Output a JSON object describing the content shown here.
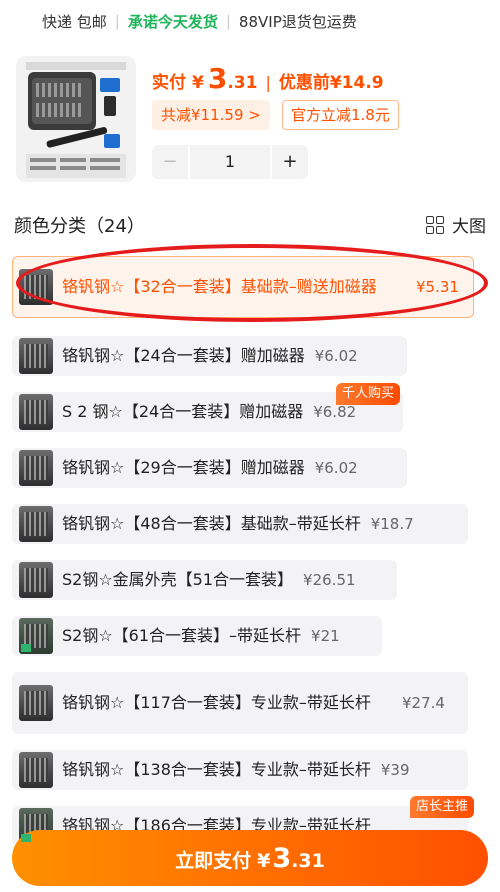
{
  "topbar": {
    "express": "快递 包邮",
    "promise": "承诺今天发货",
    "vip": "88VIP退货包运费"
  },
  "price": {
    "actual_label": "实付",
    "currency": "¥",
    "integer": "3",
    "decimal": ".31",
    "pre_label": "优惠前¥14.9"
  },
  "badges": {
    "total_discount": "共减¥11.59 >",
    "official_discount": "官方立减1.8元"
  },
  "stepper": {
    "minus": "−",
    "quantity": "1",
    "plus": "+"
  },
  "section": {
    "title": "颜色分类（24）",
    "big_view": "大图"
  },
  "options": [
    {
      "name": "铬钒钢☆【32合一套装】基础款–赠送加磁器",
      "price": "¥5.31"
    },
    {
      "name": "铬钒钢☆【24合一套装】赠加磁器",
      "price": "¥6.02"
    },
    {
      "name": "S 2 钢☆【24合一套装】赠加磁器",
      "price": "¥6.82",
      "tag": "千人购买"
    },
    {
      "name": "铬钒钢☆【29合一套装】赠加磁器",
      "price": "¥6.02"
    },
    {
      "name": "铬钒钢☆【48合一套装】基础款–带延长杆",
      "price": "¥18.7"
    },
    {
      "name": "S2钢☆金属外壳【51合一套装】",
      "price": "¥26.51"
    },
    {
      "name": "S2钢☆【61合一套装】–带延长杆",
      "price": "¥21"
    },
    {
      "name": "铬钒钢☆【117合一套装】专业款–带延长杆",
      "price": "¥27.4"
    },
    {
      "name": "铬钒钢☆【138合一套装】专业款–带延长杆",
      "price": "¥39"
    },
    {
      "name": "铬钒钢☆【186合一套装】专业款–带延长杆",
      "price": "",
      "tag": "店长主推"
    }
  ],
  "pay_button": {
    "label": "立即支付",
    "currency": "¥",
    "integer": "3",
    "decimal": ".31"
  },
  "colors": {
    "accent": "#ff5000",
    "promise_green": "#1fb35a",
    "highlight_ellipse": "#e61c1c"
  }
}
